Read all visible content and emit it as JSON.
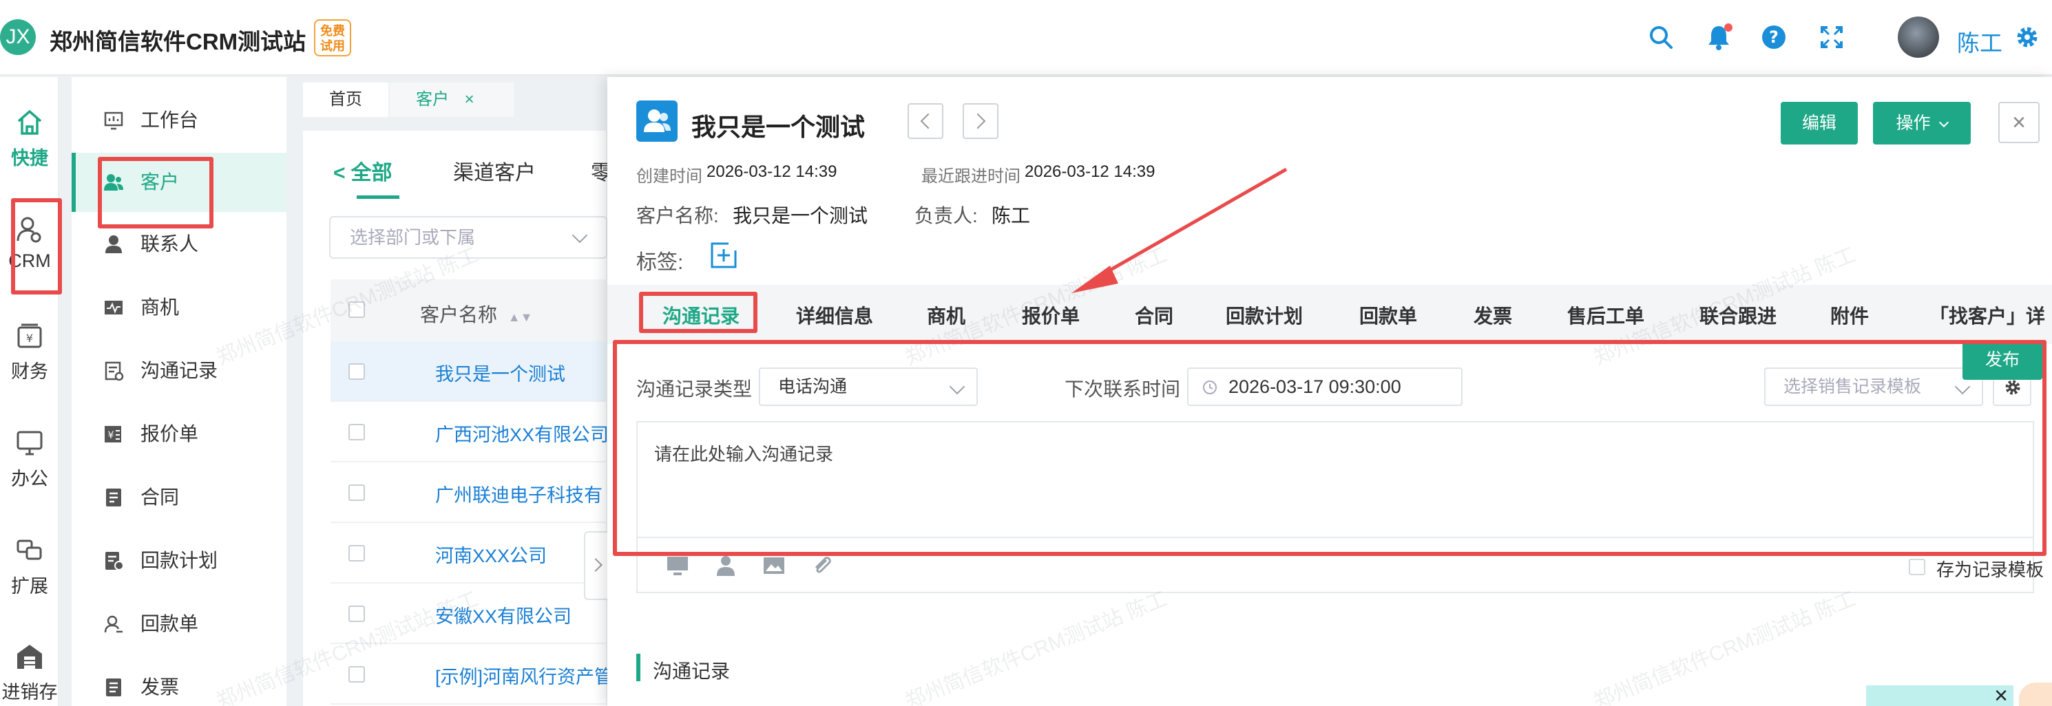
{
  "header": {
    "logo_text": "JX",
    "app_title": "郑州简信软件CRM测试站",
    "free_badge": [
      "免费",
      "试用"
    ],
    "icons": [
      "search-icon",
      "bell-icon",
      "help-icon",
      "fullscreen-icon",
      "settings-icon"
    ],
    "user_name": "陈工"
  },
  "rail": {
    "items": [
      {
        "label": "快捷",
        "icon": "home-icon"
      },
      {
        "label": "CRM",
        "icon": "crm-icon"
      },
      {
        "label": "财务",
        "icon": "finance-icon"
      },
      {
        "label": "办公",
        "icon": "monitor-icon"
      },
      {
        "label": "扩展",
        "icon": "extend-icon"
      },
      {
        "label": "进销存",
        "icon": "store-icon"
      }
    ]
  },
  "submenu": {
    "items": [
      {
        "label": "工作台",
        "icon": "dashboard-icon"
      },
      {
        "label": "客户",
        "icon": "customer-icon"
      },
      {
        "label": "联系人",
        "icon": "contact-icon"
      },
      {
        "label": "商机",
        "icon": "opportunity-icon"
      },
      {
        "label": "沟通记录",
        "icon": "record-icon"
      },
      {
        "label": "报价单",
        "icon": "quote-icon"
      },
      {
        "label": "合同",
        "icon": "contract-icon"
      },
      {
        "label": "回款计划",
        "icon": "plan-icon"
      },
      {
        "label": "回款单",
        "icon": "payment-icon"
      },
      {
        "label": "发票",
        "icon": "invoice-icon"
      }
    ]
  },
  "page_tabs": [
    {
      "label": "首页"
    },
    {
      "label": "客户",
      "close": "×"
    }
  ],
  "customer_list": {
    "filter_tabs": [
      {
        "label": "全部",
        "prefix": "<"
      },
      {
        "label": "渠道客户"
      },
      {
        "label": "零"
      }
    ],
    "dept_placeholder": "选择部门或下属",
    "column_header": "客户名称",
    "rows": [
      "我只是一个测试",
      "广西河池XX有限公司",
      "广州联迪电子科技有",
      "河南XXX公司",
      "安徽XX有限公司",
      "[示例]河南风行资产管"
    ]
  },
  "detail": {
    "title": "我只是一个测试",
    "edit_label": "编辑",
    "ops_label": "操作",
    "close_symbol": "×",
    "created_label": "创建时间",
    "created_value": "2026-03-12 14:39",
    "followup_label": "最近跟进时间",
    "followup_value": "2026-03-12 14:39",
    "customer_name_label": "客户名称:",
    "customer_name_value": "我只是一个测试",
    "owner_label": "负责人:",
    "owner_value": "陈工",
    "tags_label": "标签:",
    "tabs": [
      "沟通记录",
      "详细信息",
      "商机",
      "报价单",
      "合同",
      "回款计划",
      "回款单",
      "发票",
      "售后工单",
      "联合跟进",
      "附件",
      "「找客户」详"
    ],
    "form": {
      "type_label": "沟通记录类型",
      "type_value": "电话沟通",
      "next_contact_label": "下次联系时间",
      "next_contact_value": "2026-03-17 09:30:00",
      "template_placeholder": "选择销售记录模板",
      "textarea_placeholder": "请在此处输入沟通记录",
      "save_template_label": "存为记录模板",
      "publish_label": "发布"
    },
    "section_title": "沟通记录"
  },
  "watermark": "郑州简信软件CRM测试站 陈工",
  "colors": {
    "accent": "#1ea887",
    "link": "#1a7fd4",
    "annotation": "#e94b4b"
  }
}
